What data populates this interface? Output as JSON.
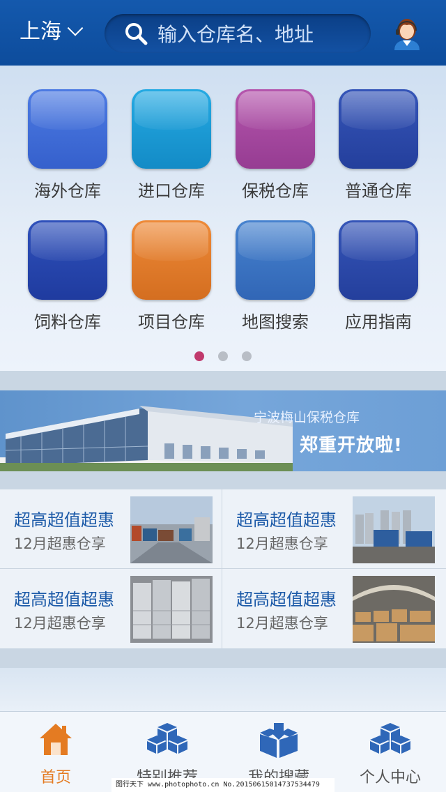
{
  "header": {
    "city": "上海",
    "search_placeholder": "输入仓库名、地址"
  },
  "categories": [
    {
      "label": "海外仓库",
      "color": "#3f6bd6"
    },
    {
      "label": "进口仓库",
      "color": "#1a9ad4"
    },
    {
      "label": "保税仓库",
      "color": "#a4479f"
    },
    {
      "label": "普通仓库",
      "color": "#2a48a8"
    },
    {
      "label": "饲料仓库",
      "color": "#2443ab"
    },
    {
      "label": "项目仓库",
      "color": "#e27a2a"
    },
    {
      "label": "地图搜索",
      "color": "#3a73c2"
    },
    {
      "label": "应用指南",
      "color": "#2a48a8"
    }
  ],
  "pager": {
    "pages": 3,
    "active": 0
  },
  "banner": {
    "line1": "宁波梅山保税仓库",
    "line2": "郑重开放啦!"
  },
  "deals": [
    {
      "title": "超高超值超惠",
      "subtitle": "12月超惠仓享"
    },
    {
      "title": "超高超值超惠",
      "subtitle": "12月超惠仓享"
    },
    {
      "title": "超高超值超惠",
      "subtitle": "12月超惠仓享"
    },
    {
      "title": "超高超值超惠",
      "subtitle": "12月超惠仓享"
    }
  ],
  "tabs": [
    {
      "label": "首页",
      "icon": "home-icon",
      "active": true
    },
    {
      "label": "特别推荐",
      "icon": "boxes-icon",
      "active": false
    },
    {
      "label": "我的搜藏",
      "icon": "box-download-icon",
      "active": false
    },
    {
      "label": "个人中心",
      "icon": "boxes-icon",
      "active": false
    }
  ],
  "watermark": "图行天下 www.photophoto.cn No.20150615014737534479",
  "colors": {
    "brand": "#0d4c9c",
    "accent": "#e47b22",
    "text_blue": "#1c5aa8"
  }
}
